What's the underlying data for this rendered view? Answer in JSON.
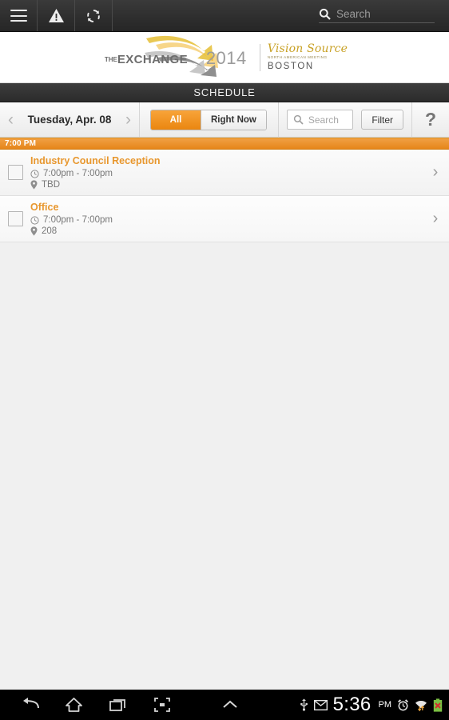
{
  "actionbar": {
    "menu_icon": "hamburger-icon",
    "alert_icon": "warning-triangle-icon",
    "refresh_icon": "refresh-icon",
    "search_icon": "search-icon",
    "search_placeholder": "Search"
  },
  "logo": {
    "the": "THE",
    "exchange": "EXCHANGE",
    "year": "2014",
    "brand_script": "Vision Source",
    "brand_sub": "NORTH AMERICAN MEETING",
    "city": "BOSTON"
  },
  "screen": {
    "title": "SCHEDULE"
  },
  "toolbar": {
    "prev_icon": "chevron-left-icon",
    "next_icon": "chevron-right-icon",
    "date": "Tuesday, Apr. 08",
    "segments": [
      {
        "label": "All",
        "active": true
      },
      {
        "label": "Right Now",
        "active": false
      }
    ],
    "search_icon": "search-icon",
    "search_placeholder": "Search",
    "search_value": "",
    "filter_label": "Filter",
    "help_label": "?"
  },
  "schedule": {
    "sections": [
      {
        "header": "7:00 PM",
        "items": [
          {
            "title": "Industry Council Reception",
            "time": "7:00pm - 7:00pm",
            "location": "TBD",
            "checked": false,
            "clock_icon": "clock-icon",
            "pin_icon": "map-pin-icon",
            "chevron_icon": "chevron-right-icon"
          },
          {
            "title": "Office",
            "time": "7:00pm - 7:00pm",
            "location": "208",
            "checked": false,
            "clock_icon": "clock-icon",
            "pin_icon": "map-pin-icon",
            "chevron_icon": "chevron-right-icon"
          }
        ]
      }
    ]
  },
  "navbar": {
    "back_icon": "back-arrow-icon",
    "home_icon": "home-icon",
    "recents_icon": "recent-apps-icon",
    "screenshot_icon": "screenshot-icon",
    "expand_icon": "chevron-up-icon",
    "usb_icon": "usb-icon",
    "mail_icon": "mail-icon",
    "time": "5:36",
    "ampm": "PM",
    "alarm_icon": "alarm-clock-icon",
    "wifi_icon": "wifi-icon",
    "battery_icon": "battery-error-icon"
  },
  "colors": {
    "accent": "#e8972e",
    "accent_dark": "#e6861a",
    "titlebar": "#2f2f2f",
    "page_bg": "#f0f0f0"
  }
}
